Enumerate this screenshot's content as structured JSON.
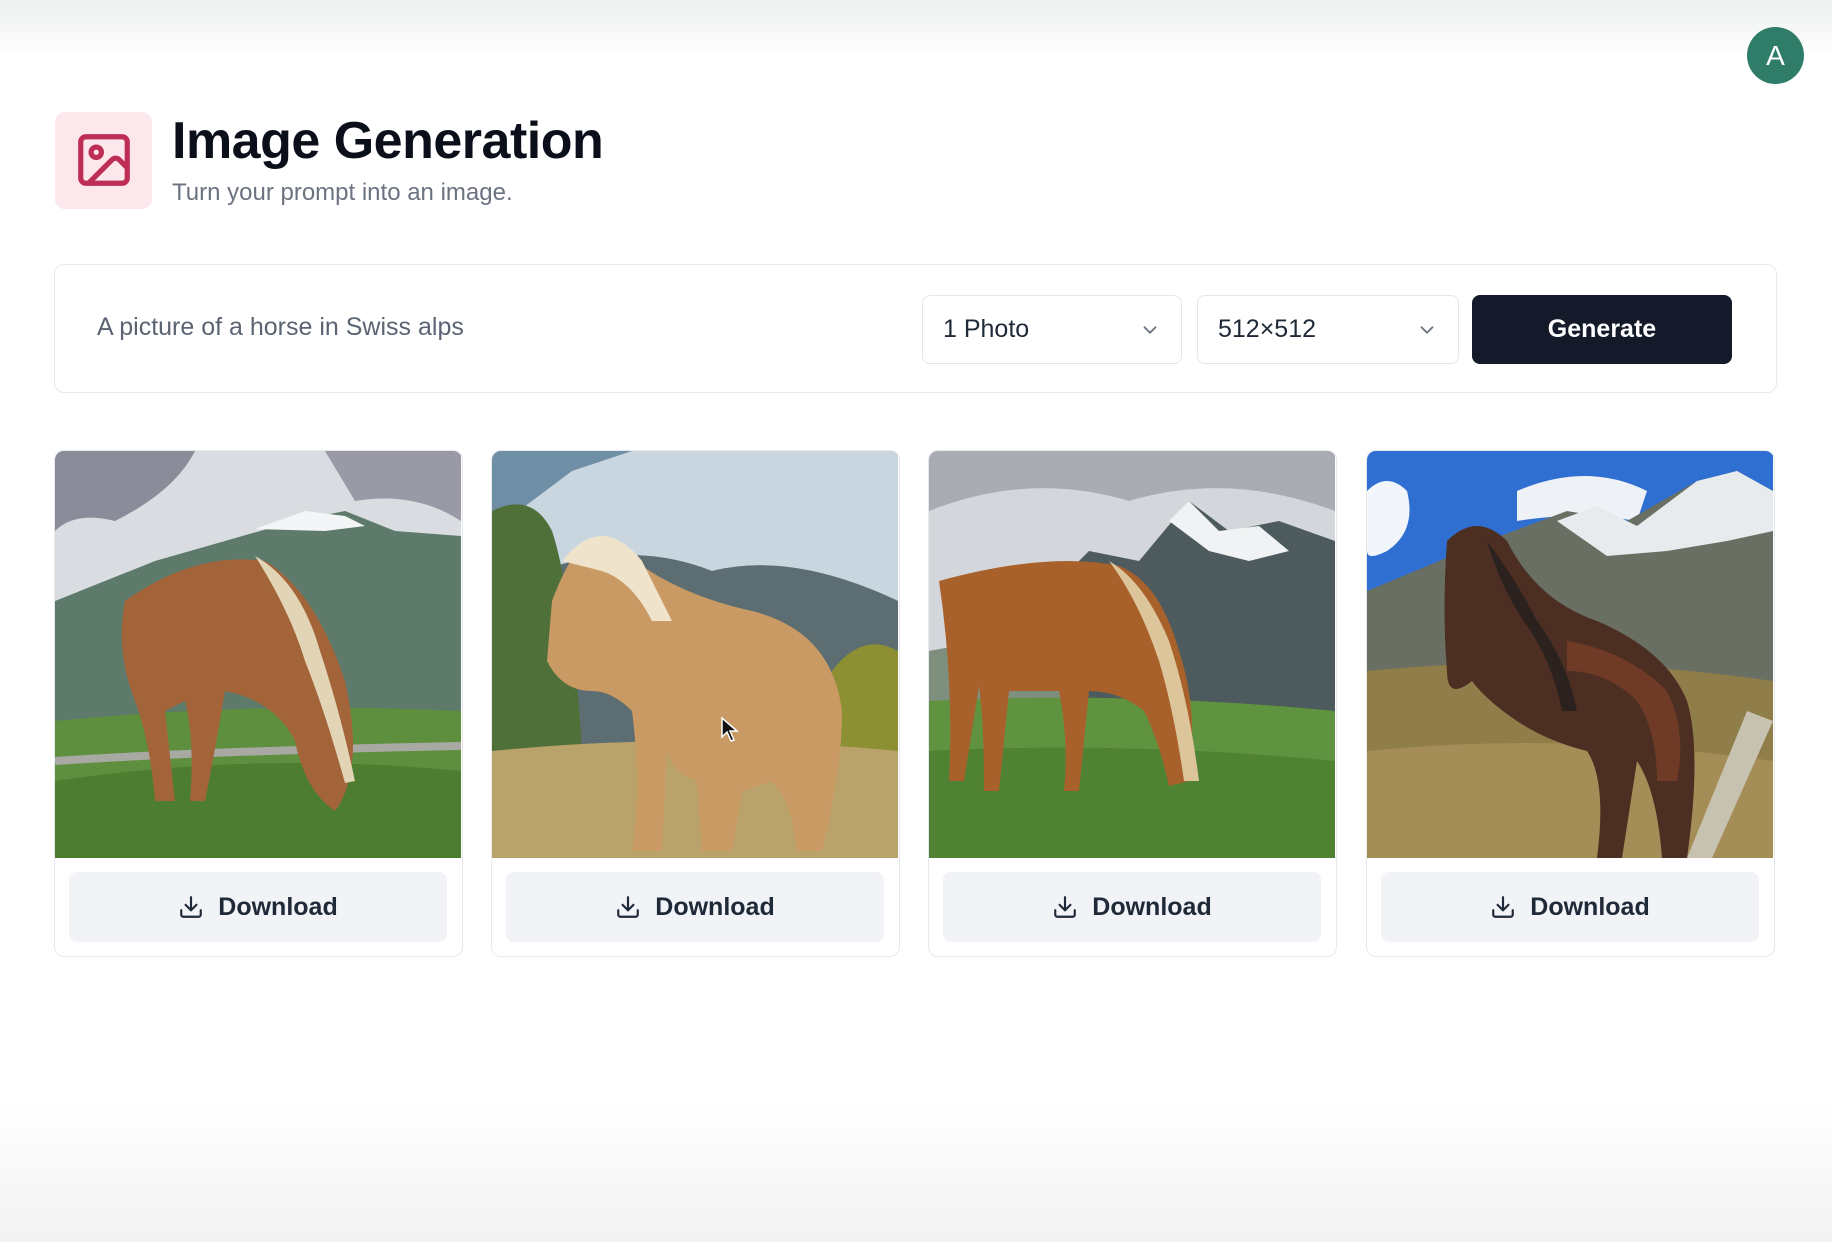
{
  "header": {
    "title": "Image Generation",
    "subtitle": "Turn your prompt into an image.",
    "icon": "image-icon",
    "icon_color": "#be2d55"
  },
  "user": {
    "avatar_initial": "A",
    "avatar_color": "#2f7d69"
  },
  "prompt": {
    "value": "A picture of a horse in Swiss alps",
    "amount_select": {
      "value": "1 Photo"
    },
    "resolution_select": {
      "value": "512×512"
    },
    "generate_label": "Generate"
  },
  "gallery": {
    "cards": [
      {
        "image": "horse grazing, chestnut with blond mane, Swiss alps",
        "download_label": "Download"
      },
      {
        "image": "palomino horse standing, snowy alpine slope",
        "download_label": "Download"
      },
      {
        "image": "chestnut horse grazing, snowy peaks",
        "download_label": "Download"
      },
      {
        "image": "dark bay horse, blue sky with alpine peaks",
        "download_label": "Download"
      }
    ]
  }
}
